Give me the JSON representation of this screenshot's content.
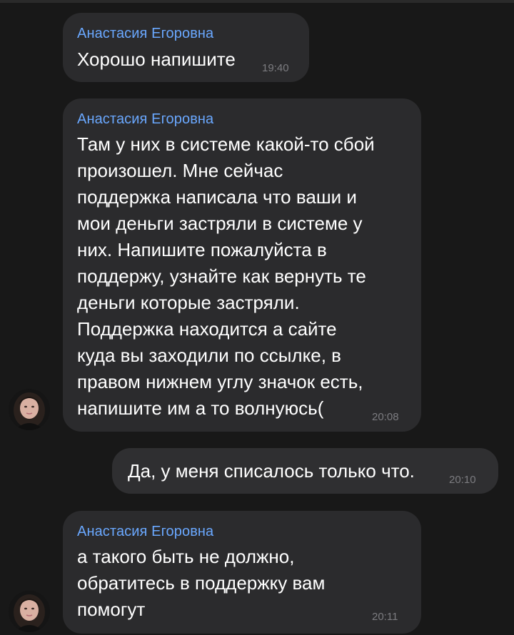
{
  "messages": [
    {
      "sender": "Анастасия Егоровна",
      "text": "Хорошо напишите",
      "time": "19:40"
    },
    {
      "sender": "Анастасия Егоровна",
      "text": "Там у них в системе какой-то сбой\nпроизошел. Мне сейчас\nподдержка написала что ваши и\nмои деньги застряли в системе у\nних. Напишите пожалуйста в\nподдержу, узнайте как вернуть те\nденьги которые застряли.\nПоддержка находится а сайте\nкуда вы заходили по ссылке, в\nправом нижнем углу значок есть,\nнапишите им а то волнуюсь(",
      "time": "20:08"
    },
    {
      "text": "Да, у меня списалось только что.",
      "time": "20:10"
    },
    {
      "sender": "Анастасия Егоровна",
      "text": "а такого быть не должно,\nобратитесь в поддержку вам\nпомогут",
      "time": "20:11"
    }
  ],
  "colors": {
    "background": "#181818",
    "bubble": "#2b2b2d",
    "sender_name": "#6aa8ff",
    "time": "#7c7c80",
    "text": "#ffffff"
  },
  "icons": {
    "avatar": "contact-avatar-photo"
  }
}
